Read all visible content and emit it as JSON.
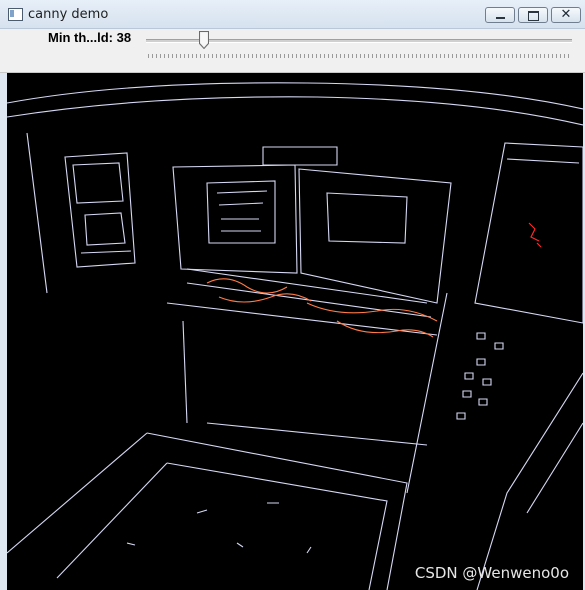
{
  "window": {
    "title": "canny demo",
    "icon": "app-window-icon",
    "controls": {
      "minimize_icon": "minimize-icon",
      "maximize_icon": "maximize-icon",
      "close_label": "✕"
    }
  },
  "trackbar": {
    "label": "Min th...ld: 38",
    "value": 38,
    "max": 300
  },
  "image": {
    "watermark": "CSDN @Wenweno0o",
    "description_colors": {
      "background": "#000000",
      "edges_primary": "#d9dcff",
      "edges_warm": "#ff7b47",
      "edges_red": "#ff2a2a"
    }
  }
}
